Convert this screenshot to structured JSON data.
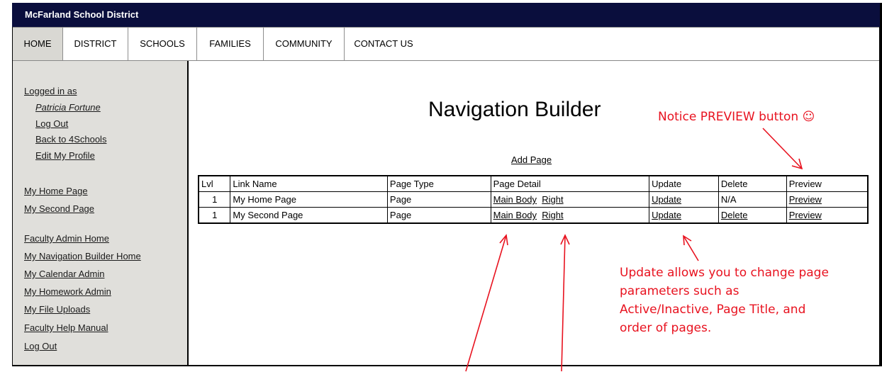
{
  "site": {
    "title": "McFarland School District"
  },
  "nav": [
    "HOME",
    "DISTRICT",
    "SCHOOLS",
    "FAMILIES",
    "COMMUNITY",
    "CONTACT US"
  ],
  "sidebar": {
    "logged_in_as": "Logged in as",
    "user_name": "Patricia Fortune",
    "log_out": "Log Out",
    "back": "Back to 4Schools",
    "edit_profile": "Edit My Profile",
    "pages": [
      "My Home Page",
      "My Second Page"
    ],
    "admin": [
      "Faculty Admin Home",
      "My Navigation Builder Home",
      "My Calendar Admin",
      "My Homework Admin",
      "My File Uploads",
      "Faculty Help Manual",
      "Log Out"
    ]
  },
  "main": {
    "title": "Navigation Builder",
    "add_page": "Add Page",
    "headers": [
      "Lvl",
      "Link Name",
      "Page Type",
      "Page Detail",
      "Update",
      "Delete",
      "Preview"
    ],
    "rows": [
      {
        "lvl": "1",
        "name": "My Home Page",
        "type": "Page",
        "detail_main": "Main Body",
        "detail_right": "Right",
        "update": "Update",
        "delete": "N/A",
        "preview": "Preview"
      },
      {
        "lvl": "1",
        "name": "My Second Page",
        "type": "Page",
        "detail_main": "Main Body",
        "detail_right": "Right",
        "update": "Update",
        "delete": "Delete",
        "preview": "Preview"
      }
    ]
  },
  "annotations": {
    "preview_note": "Notice PREVIEW button ☺",
    "update_note": [
      "Update allows you to change page",
      "parameters such as",
      "Active/Inactive, Page Title, and",
      "order of pages."
    ],
    "color": "#e8121f"
  }
}
